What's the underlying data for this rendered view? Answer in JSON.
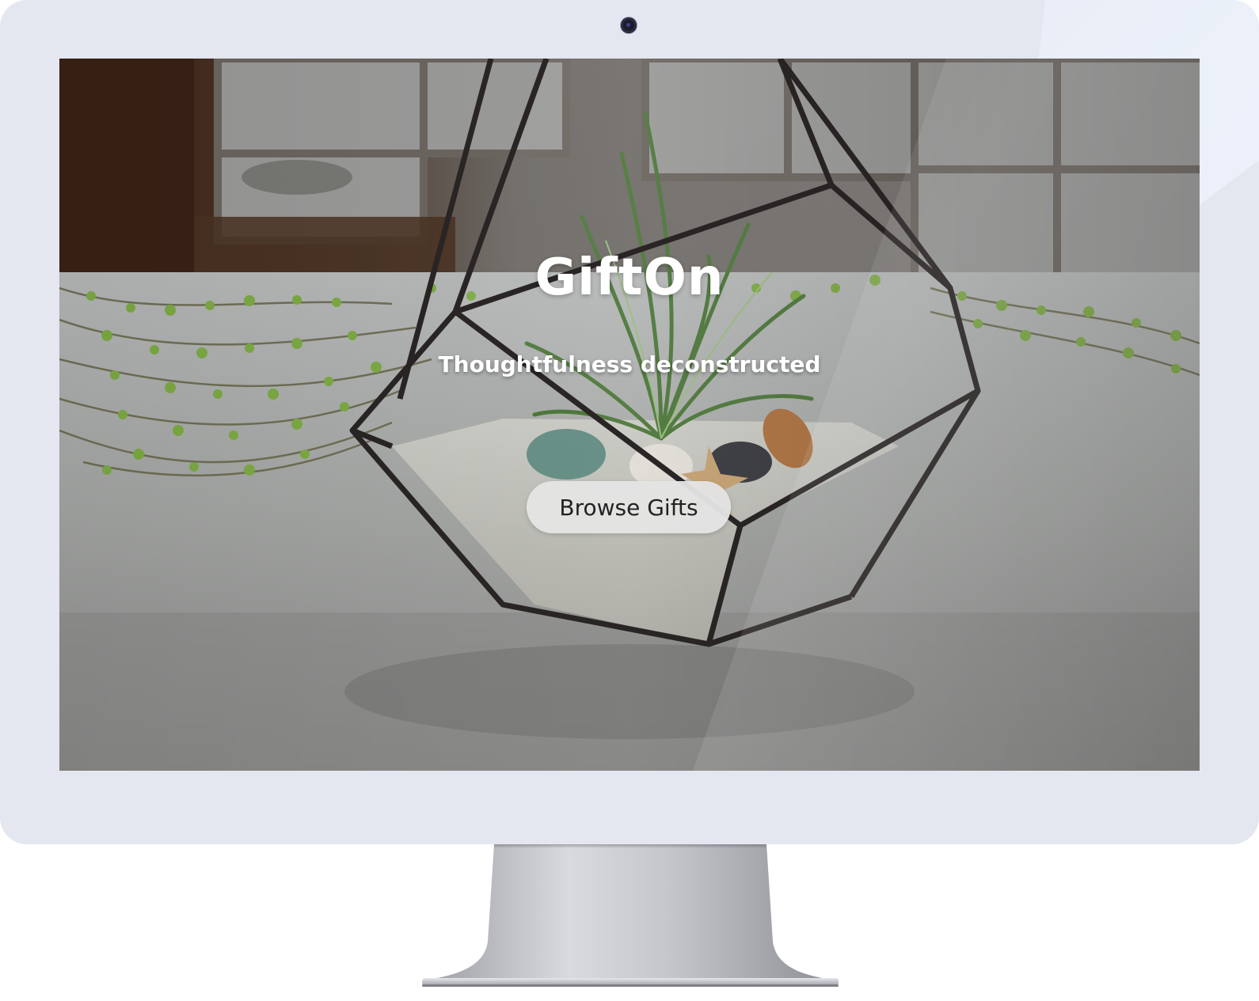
{
  "hero": {
    "title": "GiftOn",
    "subtitle": "Thoughtfulness deconstructed",
    "cta_label": "Browse Gifts"
  },
  "scene": {
    "description_icon": "terrarium-photo"
  },
  "colors": {
    "bezel": "#e4e7f0",
    "button_bg": "#e4e4e4",
    "button_text": "#222222",
    "title_text": "#ffffff"
  }
}
